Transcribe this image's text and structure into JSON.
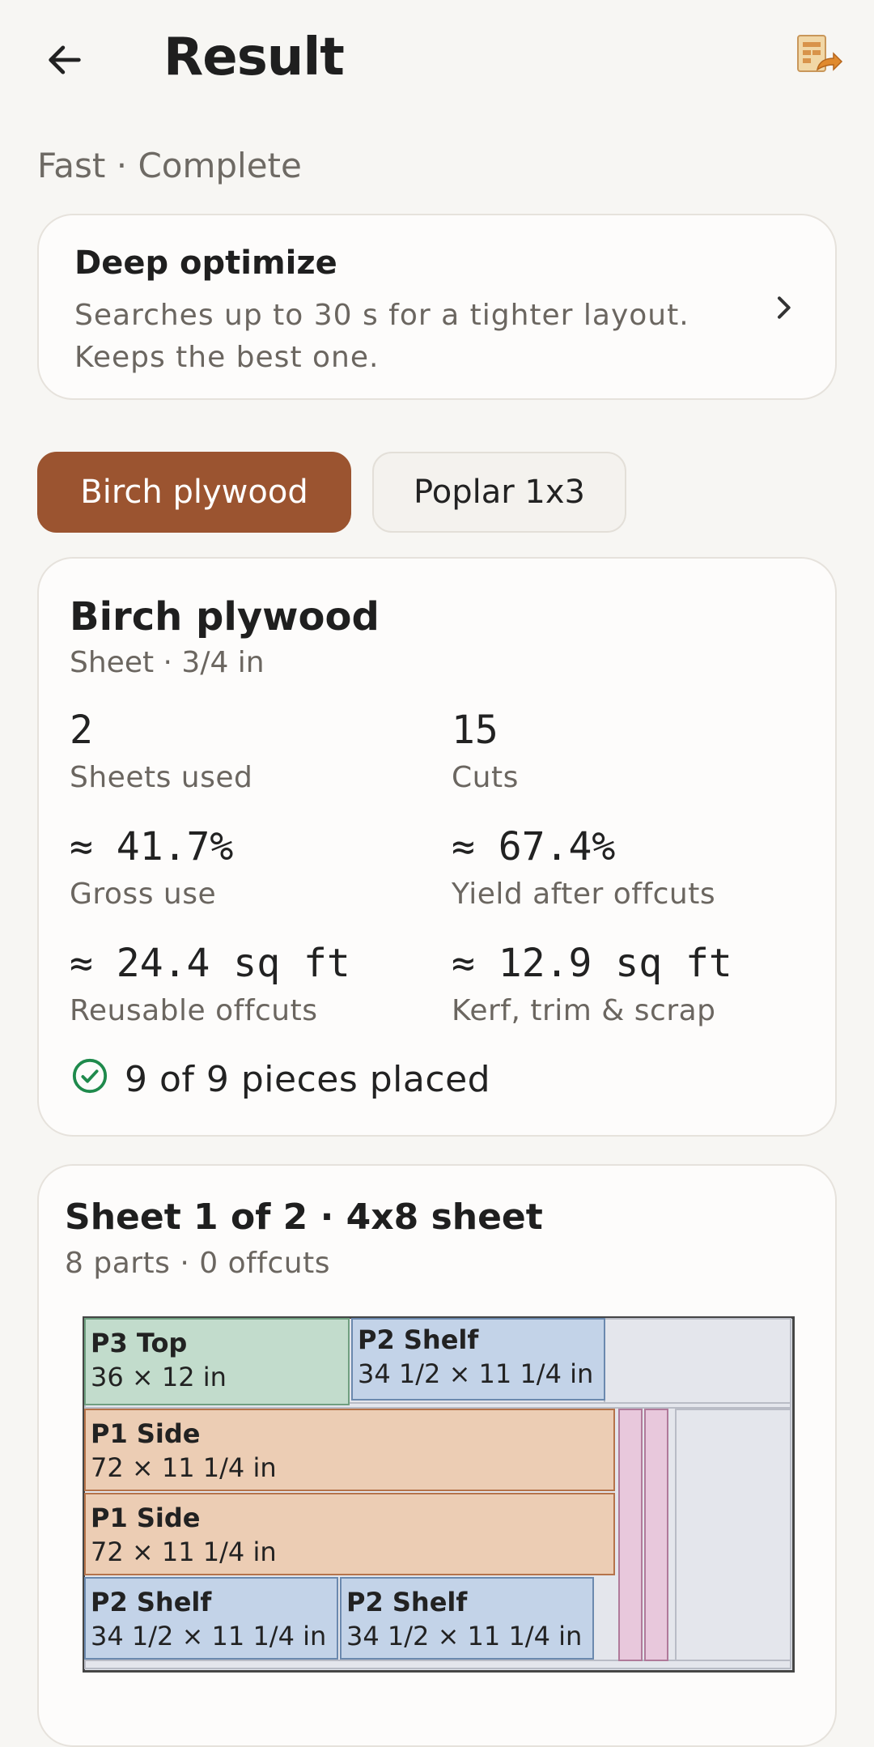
{
  "header": {
    "title": "Result"
  },
  "status": "Fast · Complete",
  "deep_optimize": {
    "title": "Deep optimize",
    "description": "Searches up to 30 s for a tighter layout. Keeps the best one."
  },
  "tabs": [
    {
      "label": "Birch plywood",
      "active": true
    },
    {
      "label": "Poplar 1x3",
      "active": false
    }
  ],
  "summary": {
    "material": "Birch plywood",
    "subtitle": "Sheet · 3/4 in",
    "stats": [
      {
        "value": "2",
        "label": "Sheets used"
      },
      {
        "value": "15",
        "label": "Cuts"
      },
      {
        "value": "≈ 41.7%",
        "label": "Gross use"
      },
      {
        "value": "≈ 67.4%",
        "label": "Yield after offcuts"
      },
      {
        "value": "≈ 24.4 sq ft",
        "label": "Reusable offcuts"
      },
      {
        "value": "≈ 12.9 sq ft",
        "label": "Kerf, trim & scrap"
      }
    ],
    "placed": "9 of 9 pieces placed"
  },
  "sheet": {
    "title": "Sheet 1 of 2 · 4x8 sheet",
    "subtitle": "8 parts · 0 offcuts",
    "parts": [
      {
        "name": "P3 Top",
        "dims": "36 × 12 in"
      },
      {
        "name": "P2 Shelf",
        "dims": "34 1/2 × 11 1/4 in"
      },
      {
        "name": "P1 Side",
        "dims": "72 × 11 1/4 in"
      },
      {
        "name": "P1 Side",
        "dims": "72 × 11 1/4 in"
      },
      {
        "name": "P2 Shelf",
        "dims": "34 1/2 × 11 1/4 in"
      },
      {
        "name": "P2 Shelf",
        "dims": "34 1/2 × 11 1/4 in"
      }
    ]
  },
  "colors": {
    "accent": "#9b5430",
    "success": "#1f8a4c",
    "part_top": "#c2dccc",
    "part_shelf": "#c3d3e8",
    "part_side": "#eccdb4",
    "part_strip": "#e8c8dc"
  },
  "icons": {
    "back": "arrow-left-icon",
    "export": "export-sheet-icon",
    "chevron": "chevron-right-icon",
    "placed": "check-circle-icon"
  }
}
